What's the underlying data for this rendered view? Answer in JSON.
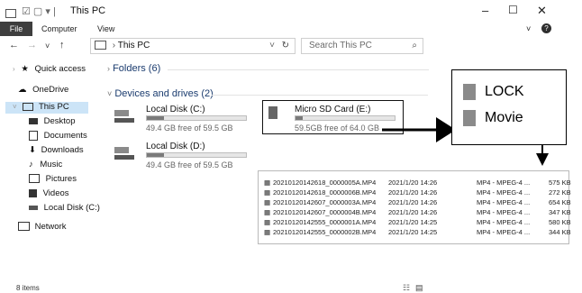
{
  "window": {
    "title": "This PC"
  },
  "ribbon": {
    "tabs": [
      "File",
      "Computer",
      "View"
    ]
  },
  "address": {
    "path": "This PC",
    "search_placeholder": "Search This PC"
  },
  "sidebar": {
    "items": [
      {
        "label": "Quick access",
        "icon": "star-icon"
      },
      {
        "label": "OneDrive",
        "icon": "cloud-icon"
      },
      {
        "label": "This PC",
        "icon": "computer-icon",
        "selected": true
      },
      {
        "label": "Desktop",
        "icon": "desktop-icon"
      },
      {
        "label": "Documents",
        "icon": "documents-icon"
      },
      {
        "label": "Downloads",
        "icon": "download-icon"
      },
      {
        "label": "Music",
        "icon": "music-icon"
      },
      {
        "label": "Pictures",
        "icon": "pictures-icon"
      },
      {
        "label": "Videos",
        "icon": "videos-icon"
      },
      {
        "label": "Local Disk (C:)",
        "icon": "drive-icon"
      },
      {
        "label": "Network",
        "icon": "network-icon"
      }
    ]
  },
  "main": {
    "folders_header": "Folders (6)",
    "drives_header": "Devices and drives (2)",
    "drives": [
      {
        "name": "Local Disk (C:)",
        "free": "49.4 GB free of 59.5 GB",
        "used_fraction": 0.17
      },
      {
        "name": "Micro SD Card (E:)",
        "free": "59.5GB free of 64.0 GB",
        "used_fraction": 0.07
      },
      {
        "name": "Local Disk (D:)",
        "free": "49.4 GB free of 59.5 GB",
        "used_fraction": 0.17
      }
    ]
  },
  "callout": {
    "folders": [
      "LOCK",
      "Movie"
    ]
  },
  "files": [
    {
      "name": "20210120142618_0000005A.MP4",
      "date": "2021/1/20 14:26",
      "type": "MP4 - MPEG-4 ...",
      "size": "575 KB"
    },
    {
      "name": "20210120142618_0000006B.MP4",
      "date": "2021/1/20 14:26",
      "type": "MP4 - MPEG-4 ...",
      "size": "272 KB"
    },
    {
      "name": "20210120142607_0000003A.MP4",
      "date": "2021/1/20 14:26",
      "type": "MP4 - MPEG-4 ...",
      "size": "654 KB"
    },
    {
      "name": "20210120142607_0000004B.MP4",
      "date": "2021/1/20 14:26",
      "type": "MP4 - MPEG-4 ...",
      "size": "347 KB"
    },
    {
      "name": "20210120142555_0000001A.MP4",
      "date": "2021/1/20 14:25",
      "type": "MP4 - MPEG-4 ...",
      "size": "580 KB"
    },
    {
      "name": "20210120142555_0000002B.MP4",
      "date": "2021/1/20 14:25",
      "type": "MP4 - MPEG-4 ...",
      "size": "344 KB"
    }
  ],
  "status": {
    "items": "8 items"
  },
  "colors": {
    "selection": "#cce4f7",
    "file_tab": "#3e3e3e",
    "header_text": "#1a3b6e"
  }
}
